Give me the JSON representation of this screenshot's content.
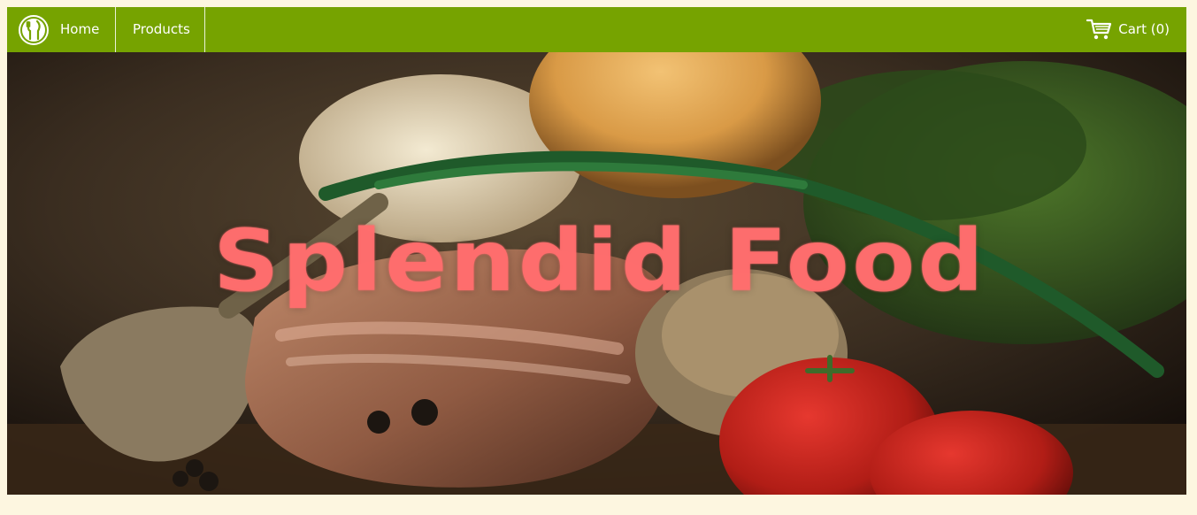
{
  "nav": {
    "home_label": "Home",
    "products_label": "Products",
    "cart_label": "Cart (0)"
  },
  "hero": {
    "title": "Splendid Food"
  },
  "colors": {
    "navbar": "#76a300",
    "page_background": "#fdf6e0",
    "hero_title": "#ff6e6e"
  },
  "icons": {
    "logo": "utensils-icon",
    "cart": "shopping-cart-icon"
  }
}
